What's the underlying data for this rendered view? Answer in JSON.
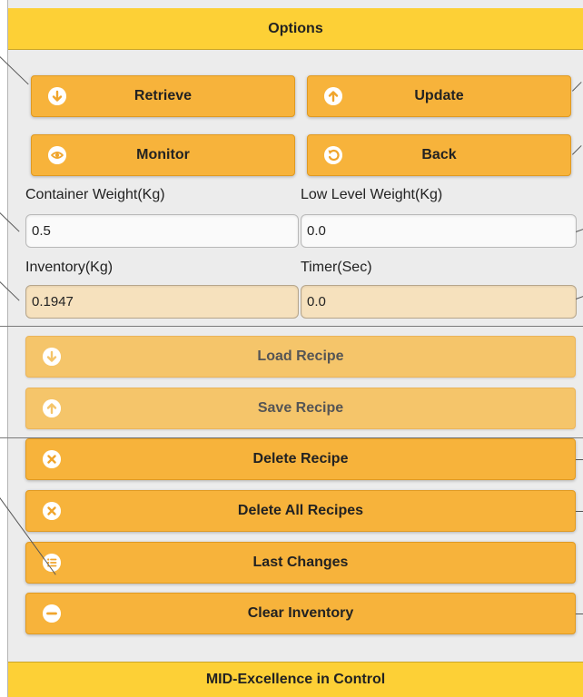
{
  "header": {
    "title": "Options"
  },
  "buttons": {
    "retrieve": "Retrieve",
    "update": "Update",
    "monitor": "Monitor",
    "back": "Back"
  },
  "fields": {
    "container_weight": {
      "label": "Container Weight(Kg)",
      "value": "0.5"
    },
    "low_level_weight": {
      "label": "Low Level Weight(Kg)",
      "value": "0.0"
    },
    "inventory": {
      "label": "Inventory(Kg)",
      "value": "0.1947"
    },
    "timer": {
      "label": "Timer(Sec)",
      "value": "0.0"
    }
  },
  "actions": {
    "load_recipe": "Load Recipe",
    "save_recipe": "Save Recipe",
    "delete_recipe": "Delete Recipe",
    "delete_all_recipes": "Delete All Recipes",
    "last_changes": "Last Changes",
    "clear_inventory": "Clear Inventory"
  },
  "footer": {
    "text": "MID-Excellence in Control"
  },
  "colors": {
    "header_bg": "#fdd036",
    "button_bg": "#f7b33b",
    "button_disabled_bg": "#f5c56a",
    "readonly_field_bg": "#f6e1bd"
  }
}
